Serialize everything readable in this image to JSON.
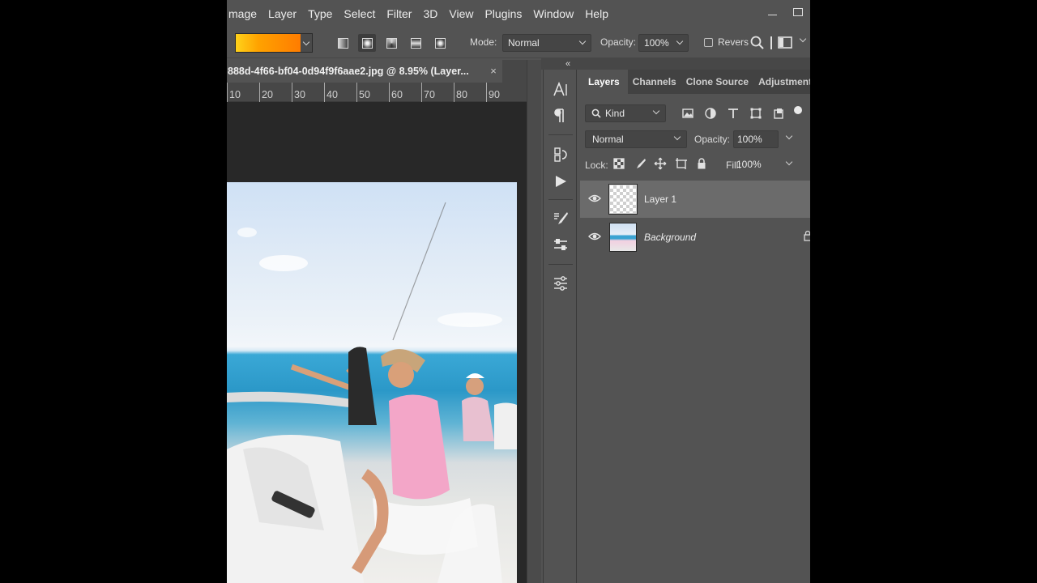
{
  "menu": {
    "items": [
      "mage",
      "Layer",
      "Type",
      "Select",
      "Filter",
      "3D",
      "View",
      "Plugins",
      "Window",
      "Help"
    ]
  },
  "window_controls": {
    "icons": [
      "minimize-icon",
      "maximize-icon"
    ]
  },
  "options_bar": {
    "gradient_colors": [
      "#ffd21a",
      "#ffa200",
      "#ff7c00"
    ],
    "gradient_types": [
      "linear",
      "radial",
      "angle",
      "reflected",
      "diamond"
    ],
    "active_gradient_type": "radial",
    "mode_label": "Mode:",
    "mode_value": "Normal",
    "opacity_label": "Opacity:",
    "opacity_value": "100%",
    "reverse_label": "Revers",
    "reverse_checked": false
  },
  "document": {
    "tab_title": "888d-4f66-bf04-0d94f9f6aae2.jpg @ 8.95% (Layer...",
    "close_glyph": "×"
  },
  "ruler": {
    "ticks": [
      "10",
      "20",
      "30",
      "40",
      "50",
      "60",
      "70",
      "80",
      "90"
    ]
  },
  "tool_strip": {
    "collapse_glyph": "«",
    "icons": [
      "character-icon",
      "paragraph-icon",
      "history-icon",
      "actions-play-icon",
      "brush-settings-icon",
      "adjustments-sliders-icon",
      "properties-icon"
    ]
  },
  "layers_panel": {
    "tabs": [
      "Layers",
      "Channels",
      "Clone Source",
      "Adjustments"
    ],
    "active_tab": "Layers",
    "filter_label": "Kind",
    "blend_mode": "Normal",
    "opacity_label": "Opacity:",
    "opacity_value": "100%",
    "lock_label": "Lock:",
    "fill_label": "Fill:",
    "fill_value": "100%",
    "layers": [
      {
        "name": "Layer 1",
        "visible": true,
        "selected": true,
        "locked": false
      },
      {
        "name": "Background",
        "visible": true,
        "selected": false,
        "locked": true
      }
    ]
  },
  "colors": {
    "ui_bg": "#535353",
    "panel_dark": "#424242",
    "canvas_bg": "#282828",
    "selected_row": "#6b6b6b"
  }
}
